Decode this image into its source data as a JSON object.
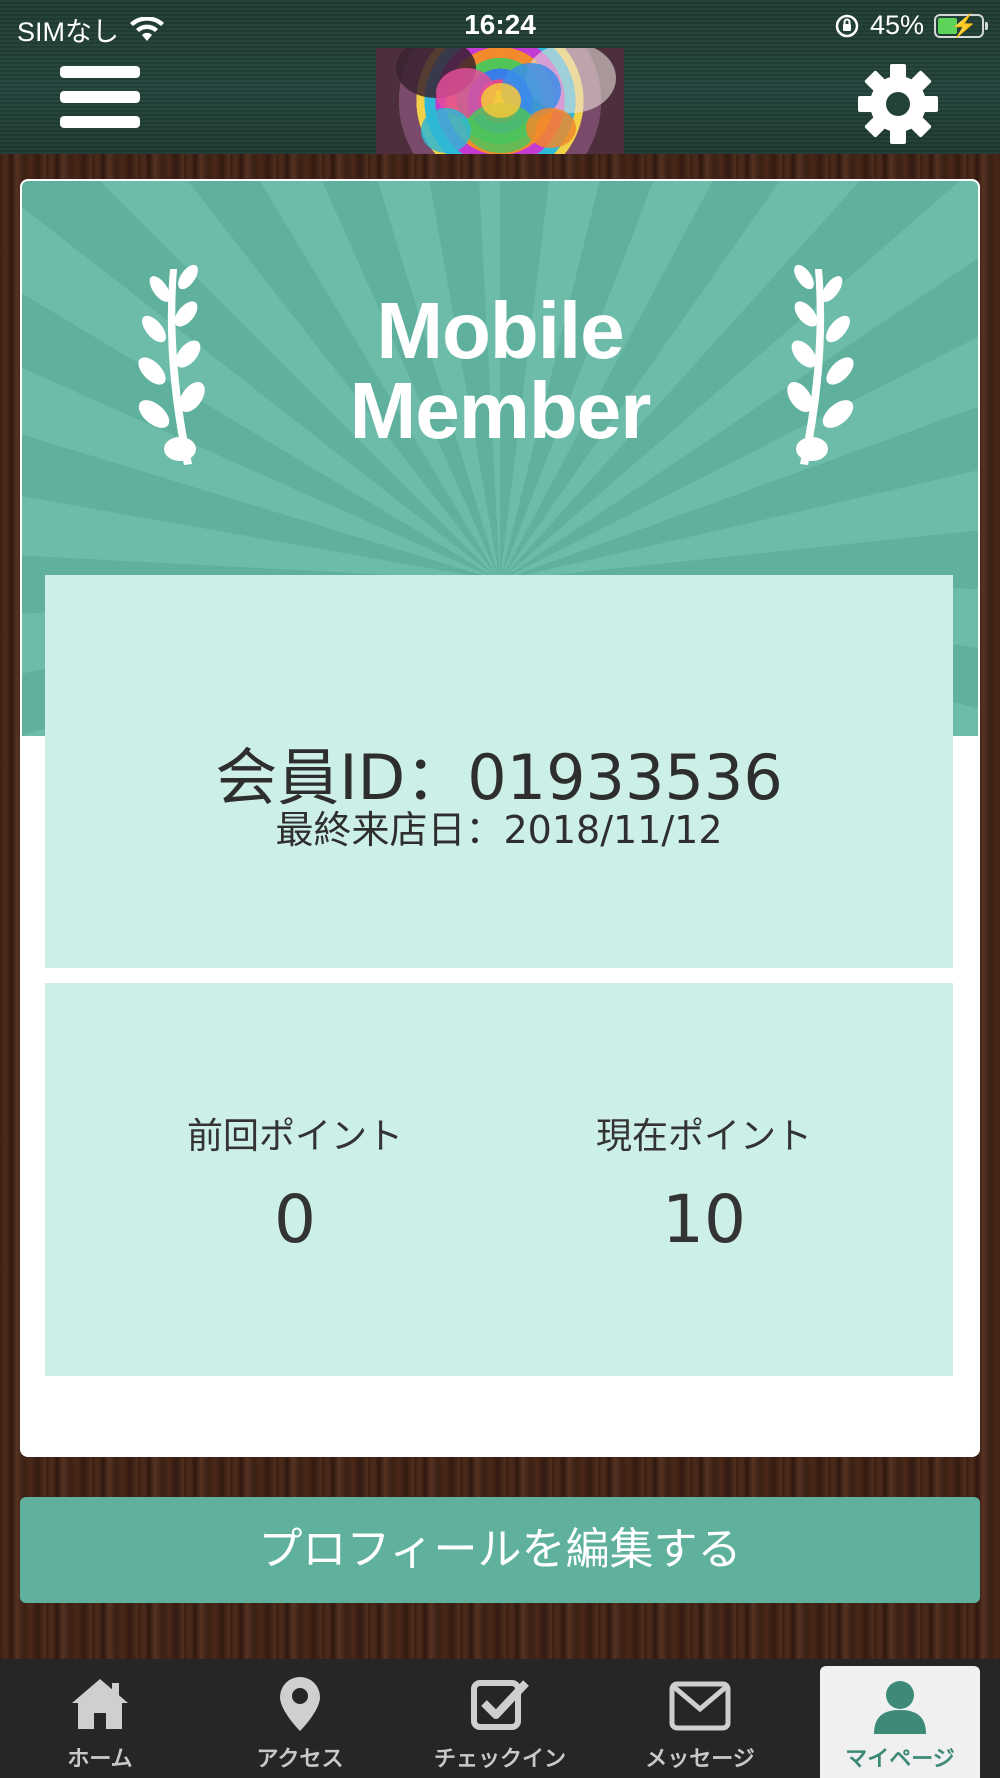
{
  "status_bar": {
    "carrier": "SIMなし",
    "time": "16:24",
    "battery_percent": "45%",
    "battery_level": 0.45
  },
  "header": {
    "menu_icon": "hamburger-menu-icon",
    "logo": "rainbow-rose-logo",
    "settings_icon": "gear-icon"
  },
  "member_card": {
    "banner_title_line1": "Mobile",
    "banner_title_line2": "Member",
    "member_id_text": "会員ID：01933536",
    "last_visit_text": "最終来店日：2018/11/12",
    "previous_points_label": "前回ポイント",
    "previous_points_value": "0",
    "current_points_label": "現在ポイント",
    "current_points_value": "10"
  },
  "edit_profile_button": "プロフィールを編集する",
  "tabs": [
    {
      "label": "ホーム",
      "icon": "home-icon"
    },
    {
      "label": "アクセス",
      "icon": "map-pin-icon"
    },
    {
      "label": "チェックイン",
      "icon": "checkbox-icon"
    },
    {
      "label": "メッセージ",
      "icon": "envelope-icon"
    },
    {
      "label": "マイページ",
      "icon": "user-icon",
      "active": true
    }
  ],
  "colors": {
    "accent": "#5fb19e",
    "panel": "#ccefe8",
    "active_tab_text": "#3e8a78"
  }
}
